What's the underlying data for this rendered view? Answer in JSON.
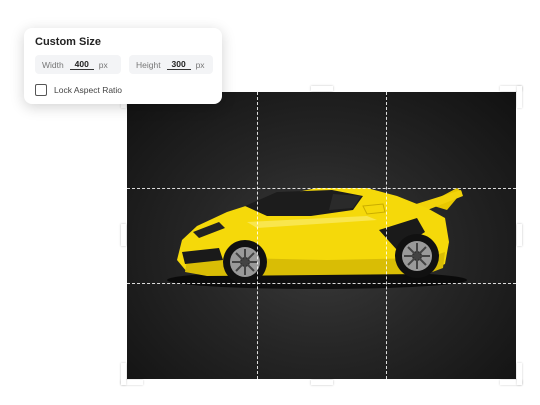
{
  "panel": {
    "title": "Custom Size",
    "width_label": "Width",
    "width_value": "400",
    "height_label": "Height",
    "height_value": "300",
    "unit": "px",
    "lock_label": "Lock Aspect Ratio",
    "lock_checked": false
  },
  "canvas": {
    "image_subject": "yellow sports car",
    "grid": "rule-of-thirds"
  },
  "colors": {
    "car_body": "#f5d90a",
    "background": "#262626",
    "grid_line": "#ffffff"
  }
}
